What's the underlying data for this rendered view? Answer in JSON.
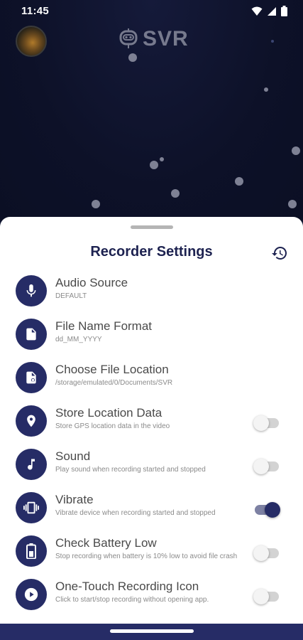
{
  "status_bar": {
    "time": "11:45"
  },
  "app": {
    "logo_text": "SVR"
  },
  "sheet": {
    "title": "Recorder Settings"
  },
  "settings": [
    {
      "title": "Audio Source",
      "subtitle": "DEFAULT",
      "icon": "microphone-icon"
    },
    {
      "title": "File Name Format",
      "subtitle": "dd_MM_YYYY",
      "icon": "file-icon"
    },
    {
      "title": "Choose File Location",
      "subtitle": "/storage/emulated/0/Documents/SVR",
      "icon": "file-location-icon"
    },
    {
      "title": "Store Location Data",
      "subtitle": "Store GPS location data in the video",
      "icon": "location-pin-icon",
      "toggle": false
    },
    {
      "title": "Sound",
      "subtitle": "Play sound when recording started and stopped",
      "icon": "music-note-icon",
      "toggle": false
    },
    {
      "title": "Vibrate",
      "subtitle": "Vibrate device when recording started and stopped",
      "icon": "vibrate-icon",
      "toggle": true
    },
    {
      "title": "Check Battery Low",
      "subtitle": "Stop recording when battery is 10% low to avoid file crash",
      "icon": "battery-icon",
      "toggle": false
    },
    {
      "title": "One-Touch Recording Icon",
      "subtitle": "Click to start/stop recording without opening app.",
      "icon": "play-circle-icon",
      "toggle": false
    }
  ],
  "colors": {
    "primary": "#262c66",
    "background_top": "#0f1430",
    "toggle_off": "#d3d3d3"
  }
}
